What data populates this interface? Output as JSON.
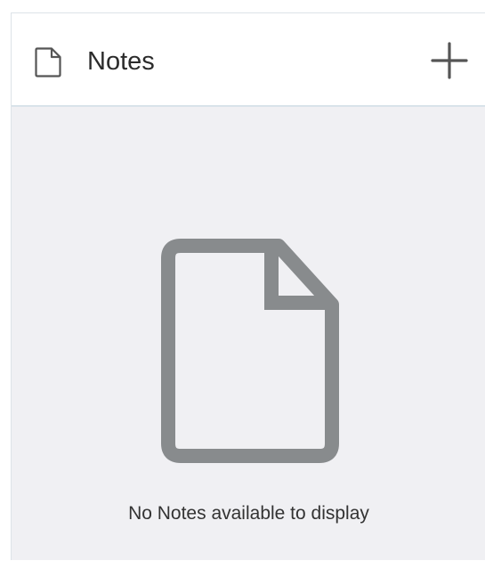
{
  "header": {
    "title": "Notes",
    "icon": "document-icon",
    "add_button_icon": "plus-icon"
  },
  "empty_state": {
    "icon": "document-icon",
    "message": "No Notes available to display"
  },
  "colors": {
    "header_background": "#ffffff",
    "body_background": "#f0f0f3",
    "divider": "#d9e3ea",
    "icon_gray": "#888b8d",
    "text": "#333333"
  }
}
